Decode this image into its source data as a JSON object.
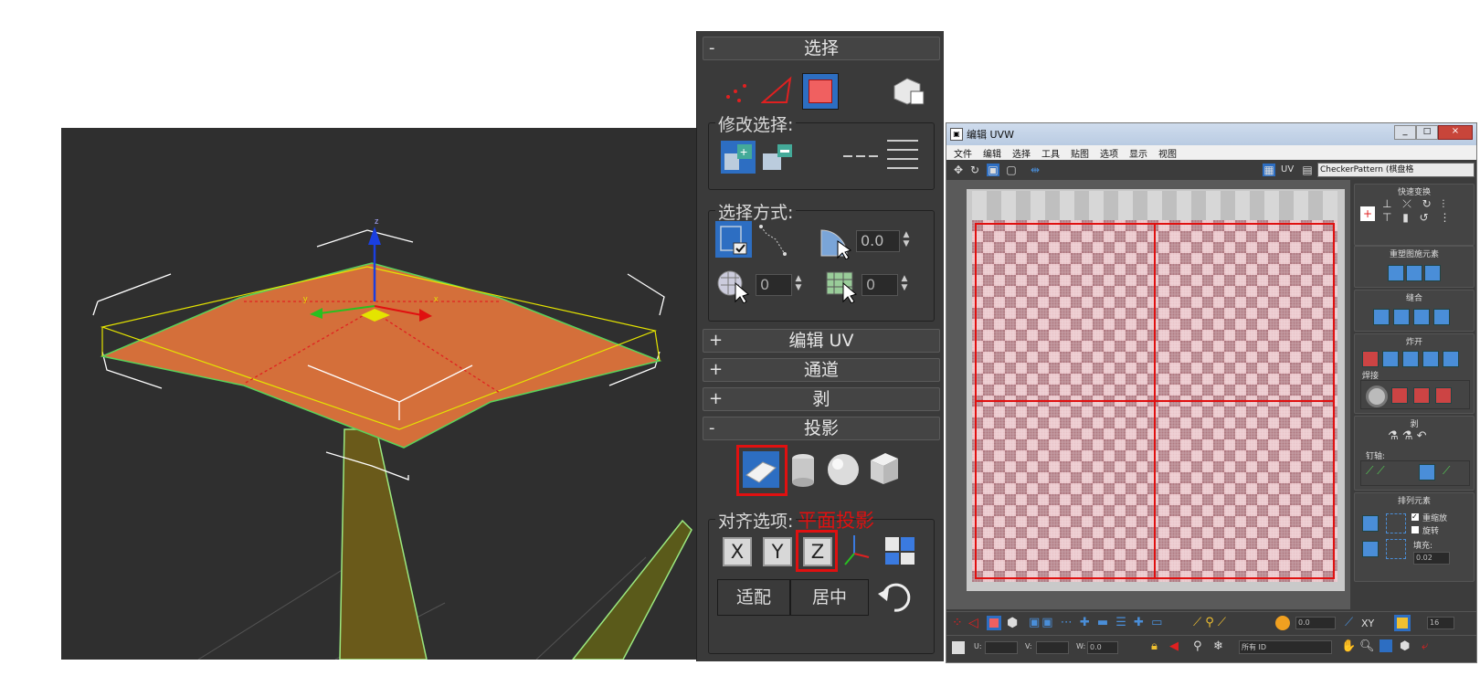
{
  "viewport": {
    "gizmo_axis_labels": {
      "x": "x",
      "y": "y",
      "z": "z"
    },
    "colors": {
      "plane": "#d46f3a",
      "wire": "#e4e400",
      "edge": "#5ad35a",
      "trunk": "#6a5a1a"
    }
  },
  "modifier_panel": {
    "selection": {
      "title": "选择",
      "sign": "-"
    },
    "modify_selection": {
      "label": "修改选择:"
    },
    "select_by": {
      "label": "选择方式:",
      "angle_value": "0.0",
      "spin1_value": "0",
      "spin2_value": "0"
    },
    "rollouts": [
      {
        "sign": "+",
        "title": "编辑 UV"
      },
      {
        "sign": "+",
        "title": "通道"
      },
      {
        "sign": "+",
        "title": "剥"
      }
    ],
    "projection": {
      "title": "投影",
      "sign": "-"
    },
    "align": {
      "label": "对齐选项:",
      "annotation": "平面投影",
      "x_label": "X",
      "y_label": "Y",
      "z_label": "Z",
      "fit_label": "适配",
      "center_label": "居中"
    },
    "colors": {
      "highlight": "#e01010",
      "selected_button": "#2d6ec2"
    }
  },
  "uvw_editor": {
    "title": "编辑 UVW",
    "menu": [
      "文件",
      "编辑",
      "选择",
      "工具",
      "贴图",
      "选项",
      "显示",
      "视图"
    ],
    "uv_label": "UV",
    "texture_dropdown": "CheckerPattern  (棋盘格",
    "right_panel": {
      "quick_transform": "快速变换",
      "reshape": "重塑图施元素",
      "stitch": "缝合",
      "explode": "炸开",
      "weld": "焊接",
      "peel": "剥",
      "pins": "钉轴:",
      "arrange": "排列元素",
      "rescale_label": "重缩放",
      "rotate_label": "旋转",
      "padding_label": "填充:",
      "padding_value": "0.02"
    },
    "bottom": {
      "spin_value": "0.0",
      "xy_label": "XY",
      "grid_value": "16",
      "u_label": "U:",
      "v_label": "V:",
      "w_label": "W:",
      "w_value": "0.0",
      "id_dropdown": "所有 ID"
    },
    "colors": {
      "checker_a": "#e9c3c8",
      "checker_b": "#b07a82",
      "uv_lines": "#e01010"
    }
  }
}
